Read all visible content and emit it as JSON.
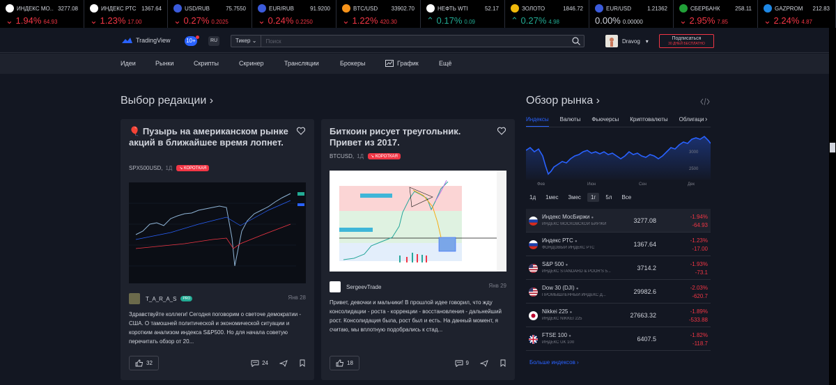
{
  "ticker": [
    {
      "name": "ИНДЕКС МО...",
      "price": "3277.08",
      "pct": "1.94%",
      "abs": "64.93",
      "dir": "neg",
      "icon_color": "#ffffff"
    },
    {
      "name": "ИНДЕКС РТС",
      "price": "1367.64",
      "pct": "1.23%",
      "abs": "17.00",
      "dir": "neg",
      "icon_color": "#ffffff"
    },
    {
      "name": "USD/RUB",
      "price": "75.7550",
      "pct": "0.27%",
      "abs": "0.2025",
      "dir": "neg",
      "icon_color": "#3b5bdb"
    },
    {
      "name": "EUR/RUB",
      "price": "91.9200",
      "pct": "0.24%",
      "abs": "0.2250",
      "dir": "neg",
      "icon_color": "#3b5bdb"
    },
    {
      "name": "BTC/USD",
      "price": "33902.70",
      "pct": "1.22%",
      "abs": "420.30",
      "dir": "neg",
      "icon_color": "#f7931a"
    },
    {
      "name": "НЕФТЬ WTI",
      "price": "52.17",
      "pct": "0.17%",
      "abs": "0.09",
      "dir": "pos",
      "icon_color": "#ffffff"
    },
    {
      "name": "ЗОЛОТО",
      "price": "1846.72",
      "pct": "0.27%",
      "abs": "4.98",
      "dir": "pos",
      "icon_color": "#f0b90b"
    },
    {
      "name": "EUR/USD",
      "price": "1.21362",
      "pct": "0.00%",
      "abs": "0.00000",
      "dir": "neu",
      "icon_color": "#3b5bdb"
    },
    {
      "name": "СБЕРБАНК",
      "price": "258.11",
      "pct": "2.95%",
      "abs": "7.85",
      "dir": "neg",
      "icon_color": "#21a038"
    },
    {
      "name": "GAZPROM",
      "price": "212.83",
      "pct": "2.24%",
      "abs": "4.87",
      "dir": "neg",
      "icon_color": "#1e88e5"
    }
  ],
  "header": {
    "logo_text": "TradingView",
    "notifications": "10+",
    "lang": "RU",
    "search_type": "Тикер",
    "search_placeholder": "Поиск",
    "username": "Dravog",
    "subscribe_main": "Подписаться",
    "subscribe_sub": "30 ДНЕЙ БЕСПЛАТНО"
  },
  "nav": [
    "Идеи",
    "Рынки",
    "Скрипты",
    "Скринер",
    "Трансляции",
    "Брокеры",
    "График",
    "Ещё"
  ],
  "editors": {
    "title": "Выбор редакции ›",
    "cards": [
      {
        "title": "Пузырь на американском рынке акций в ближайшее время лопнет.",
        "ticker": "SPX500USD",
        "timeframe": "1Д",
        "badge": "↘ КОРОТКАЯ",
        "author": "T_A_R_A_S",
        "pro": "PRO",
        "date": "Янв 28",
        "text": "Здравствуйте коллеги! Сегодня поговорим о светоче демократии - США. О тамошней политической и экономической ситуации и коротким анализом индекса S&P500. Но для начала советую перечитать обзор от 20...",
        "likes": "32",
        "comments": "24"
      },
      {
        "title": "Биткоин рисует треугольник. Привет из 2017.",
        "ticker": "BTCUSD",
        "timeframe": "1Д",
        "badge": "↘ КОРОТКАЯ",
        "author": "SergeevTrade",
        "date": "Янв 29",
        "text": "Привет, девочки и мальчики! В прошлой идее говорил, что жду консолидации - роста - коррекции - восстановления - дальнейший рост. Консолидация была, рост был и есть. На данный момент, я считаю, мы вплотную подобрались к стад...",
        "likes": "18",
        "comments": "9"
      }
    ]
  },
  "market": {
    "title": "Обзор рынка ›",
    "tabs": [
      "Индексы",
      "Валюты",
      "Фьючерсы",
      "Криптовалюты",
      "Облигации"
    ],
    "active_tab": 0,
    "chart_labels": {
      "months": [
        "Фев",
        "Июн",
        "Сен",
        "Дек"
      ],
      "yticks": [
        "3000",
        "2500"
      ]
    },
    "ranges": [
      "1д",
      "1мес",
      "3мес",
      "1г",
      "5л",
      "Все"
    ],
    "active_range": 3,
    "indices": [
      {
        "name": "Индекс МосБиржи",
        "sub": "ИНДЕКС МОСКОВСКОЙ БИРЖИ",
        "price": "3277.08",
        "pct": "-1.94%",
        "abs": "-64.93",
        "flag": "ru"
      },
      {
        "name": "Индекс РТС",
        "sub": "ФОНДОВЫЙ ИНДЕКС РТС",
        "price": "1367.64",
        "pct": "-1.23%",
        "abs": "-17.00",
        "flag": "ru"
      },
      {
        "name": "S&P 500",
        "sub": "ИНДЕКС STANDARD & POOR'S 5...",
        "price": "3714.2",
        "pct": "-1.93%",
        "abs": "-73.1",
        "flag": "us"
      },
      {
        "name": "Dow 30 (DJI)",
        "sub": "ПРОМЫШЛЕННЫЙ ИНДЕКС Д...",
        "price": "29982.6",
        "pct": "-2.03%",
        "abs": "-620.7",
        "flag": "us"
      },
      {
        "name": "Nikkei 225",
        "sub": "ИНДЕКС NIKKEI 225",
        "price": "27663.32",
        "pct": "-1.89%",
        "abs": "-533.88",
        "flag": "jp"
      },
      {
        "name": "FTSE 100",
        "sub": "ИНДЕКС UK 100",
        "price": "6407.5",
        "pct": "-1.82%",
        "abs": "-118.7",
        "flag": "uk"
      }
    ],
    "more_link": "Больше индексов ›"
  }
}
